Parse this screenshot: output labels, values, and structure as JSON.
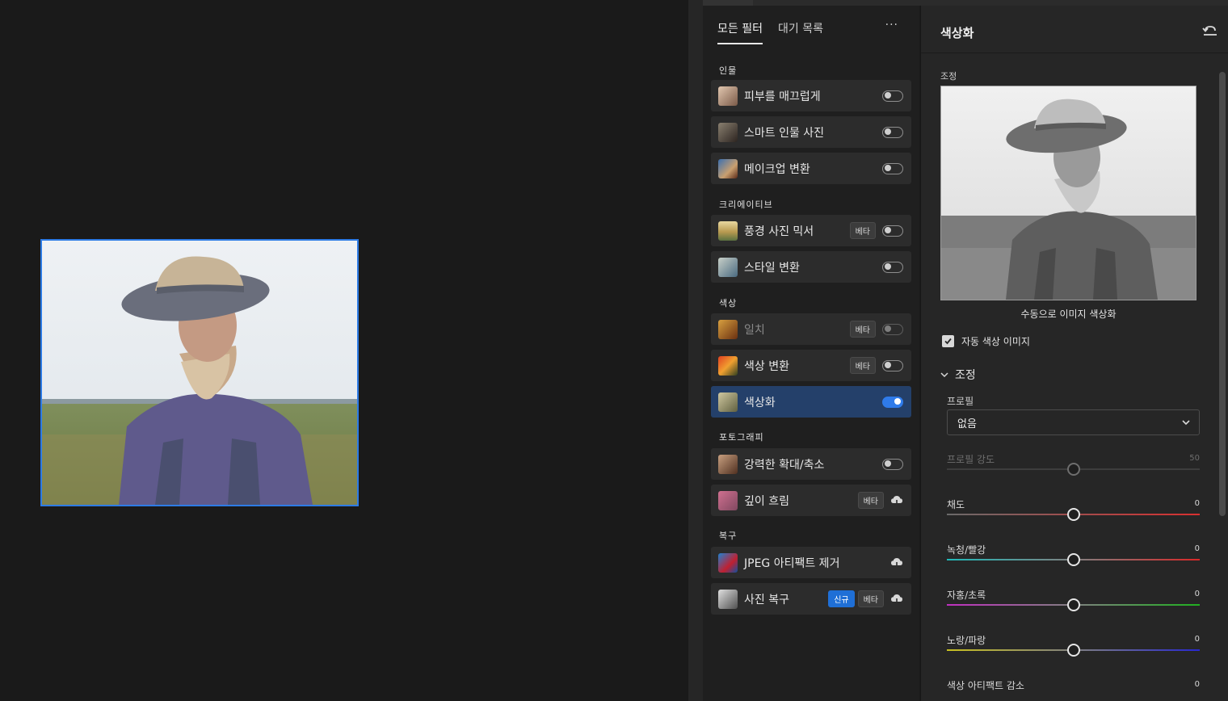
{
  "filters_panel": {
    "tabs": [
      {
        "label": "모든 필터",
        "active": true
      },
      {
        "label": "대기 목록",
        "active": false
      }
    ],
    "more_label": "···",
    "sections": [
      {
        "label": "인물"
      },
      {
        "label": "크리에이티브"
      },
      {
        "label": "색상"
      },
      {
        "label": "포토그래피"
      },
      {
        "label": "복구"
      }
    ],
    "items": [
      {
        "label": "피부를 매끄럽게",
        "badges": [],
        "control": "toggle",
        "on": false
      },
      {
        "label": "스마트 인물 사진",
        "badges": [],
        "control": "toggle",
        "on": false
      },
      {
        "label": "메이크업 변환",
        "badges": [],
        "control": "toggle",
        "on": false
      },
      {
        "label": "풍경 사진 믹서",
        "badges": [
          "베타"
        ],
        "control": "toggle",
        "on": false
      },
      {
        "label": "스타일 변환",
        "badges": [],
        "control": "toggle",
        "on": false
      },
      {
        "label": "일치",
        "badges": [
          "베타"
        ],
        "control": "toggle",
        "on": false,
        "disabled": true
      },
      {
        "label": "색상 변환",
        "badges": [
          "베타"
        ],
        "control": "toggle",
        "on": false
      },
      {
        "label": "색상화",
        "badges": [],
        "control": "toggle",
        "on": true,
        "selected": true
      },
      {
        "label": "강력한 확대/축소",
        "badges": [],
        "control": "toggle",
        "on": false
      },
      {
        "label": "깊이 흐림",
        "badges": [
          "베타"
        ],
        "control": "cloud-download"
      },
      {
        "label": "JPEG 아티팩트 제거",
        "badges": [],
        "control": "cloud-download"
      },
      {
        "label": "사진 복구",
        "new_badge": "신규",
        "badges": [
          "베타"
        ],
        "control": "cloud-download"
      }
    ]
  },
  "properties": {
    "title": "색상화",
    "preview_section_label": "조정",
    "preview_caption": "수동으로 이미지 색상화",
    "auto_color_checkbox": {
      "label": "자동 색상 이미지",
      "checked": true
    },
    "adjust_accordion": "조정",
    "profile": {
      "label": "프로필",
      "value": "없음"
    },
    "sliders": [
      {
        "label": "프로필 강도",
        "value": "50",
        "position": 0.5,
        "disabled": true
      },
      {
        "label": "채도",
        "value": "0",
        "position": 0.5
      },
      {
        "label": "녹청/빨강",
        "value": "0",
        "position": 0.5
      },
      {
        "label": "자홍/초록",
        "value": "0",
        "position": 0.5
      },
      {
        "label": "노랑/파랑",
        "value": "0",
        "position": 0.5
      },
      {
        "label": "색상 아티팩트 감소",
        "value": "0"
      }
    ]
  },
  "colors": {
    "accent": "#2f7bea",
    "selected_row": "#24406a",
    "new_badge": "#1f6fd6"
  }
}
